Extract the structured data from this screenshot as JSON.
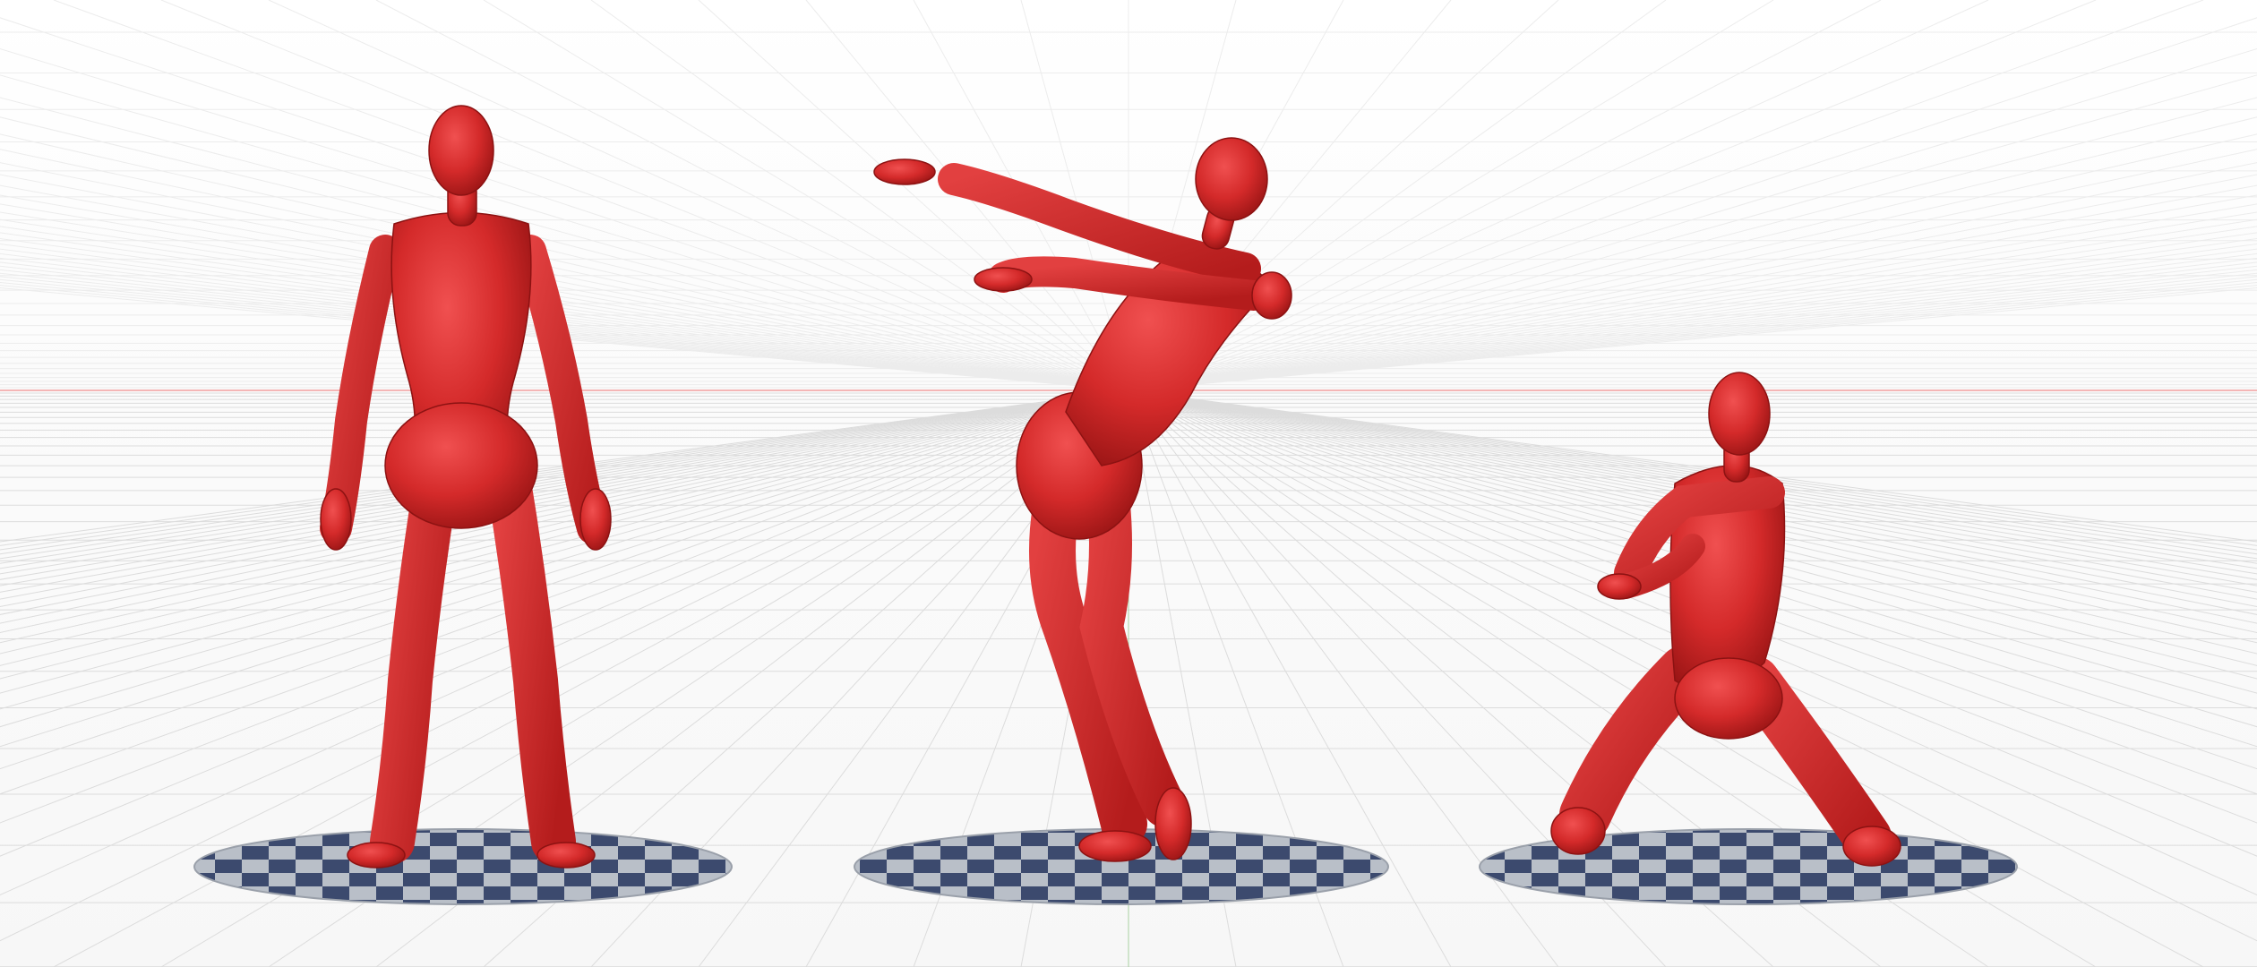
{
  "viewport": {
    "background": "#ffffff",
    "grid_color": "#dcdcdc",
    "horizon_color": "#f2a0a0",
    "figure_color": "#d42a2a",
    "pedestal_dark": "#3c4a6e",
    "pedestal_light": "#b9bfc8"
  },
  "figures": [
    {
      "name": "standing-pose"
    },
    {
      "name": "reaching-pose"
    },
    {
      "name": "kneeling-pose"
    }
  ]
}
